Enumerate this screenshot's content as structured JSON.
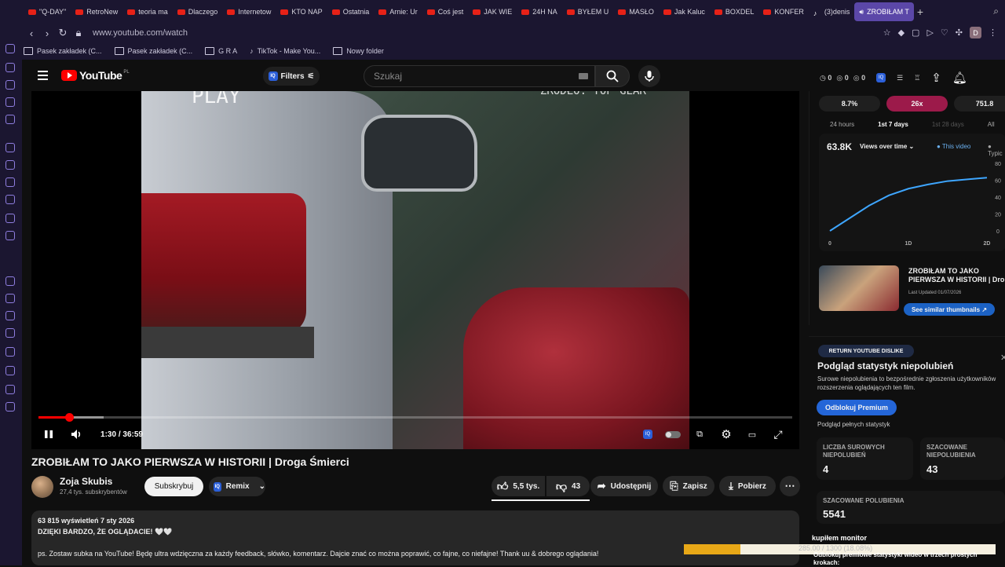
{
  "browser": {
    "tabs": [
      {
        "label": "\"Q-DAY\""
      },
      {
        "label": "RetroNew"
      },
      {
        "label": "teoria ma"
      },
      {
        "label": "Dlaczego"
      },
      {
        "label": "Internetow"
      },
      {
        "label": "KTO NAP"
      },
      {
        "label": "Ostatnia"
      },
      {
        "label": "Arnie: Ur"
      },
      {
        "label": "Coś jest"
      },
      {
        "label": "JAK WIE"
      },
      {
        "label": "24H NA"
      },
      {
        "label": "BYŁEM U"
      },
      {
        "label": "MASŁO"
      },
      {
        "label": "Jak Kaluc"
      },
      {
        "label": "BOXDEL"
      },
      {
        "label": "KONFER"
      },
      {
        "label": "(3)denis"
      },
      {
        "label": "ZROBIŁAM T"
      }
    ],
    "url": "www.youtube.com/watch",
    "avatar_letter": "D",
    "bookmarks": [
      {
        "label": "Pasek zakładek (C..."
      },
      {
        "label": "Pasek zakładek (C..."
      },
      {
        "label": "G R A"
      },
      {
        "label": "TikTok - Make You..."
      },
      {
        "label": "Nowy folder"
      }
    ]
  },
  "youtube": {
    "logo_text": "YouTube",
    "logo_region": "PL",
    "filters_label": "Filters",
    "search_placeholder": "Szukaj",
    "counts": [
      "0",
      "0",
      "0"
    ],
    "accent": "#ff0000"
  },
  "video": {
    "watermark_left": "PLAY",
    "watermark_right": "ŹRÓDŁO: TOP GEAR",
    "time": "1:30 / 36:59",
    "played_fraction": 0.041,
    "buffered_fraction": 0.086
  },
  "info": {
    "title": "ZROBIŁAM TO JAKO PIERWSZA W HISTORII | Droga Śmierci",
    "channel": "Zoja Skubis",
    "subs": "27,4 tys. subskrybentów",
    "subscribe": "Subskrybuj",
    "remix": "Remix",
    "likes": "5,5 tys.",
    "dislikes": "43",
    "share": "Udostępnij",
    "save": "Zapisz",
    "download": "Pobierz"
  },
  "description": {
    "line1": "63 815 wyświetleń  7 sty 2026",
    "line2": "DZIĘKI BARDZO, ŻE OGLĄDACIE! 🤍🤍",
    "line3": "ps. Zostaw subka na YouTube! Będę ultra wdzięczna za każdy feedback, słówko, komentarz. Dajcie znać co można poprawić, co fajne, co niefajne! Thank uu & dobrego oglądania!"
  },
  "stats_panel": {
    "pills": [
      "8.7%",
      "26x",
      "751.8"
    ],
    "tabs": [
      "24 hours",
      "1st 7 days",
      "1st 28 days",
      "All"
    ],
    "big": "63.8K",
    "mode": "Views over time ⌄",
    "legend_this": "This video",
    "legend_typical": "Typic",
    "thumb_title": "ZROBIŁAM TO JAKO PIERWSZA W HISTORII | Dro",
    "updated": "Last Updated 01/07/2026",
    "similar": "See similar thumbnails ↗",
    "accent": "#9c1a4a"
  },
  "chart_data": {
    "type": "line",
    "title": "",
    "x": [
      "0",
      "1D",
      "2D"
    ],
    "xlabel": "",
    "ylabel": "",
    "yticks": [
      "0",
      "20",
      "40",
      "60",
      "80"
    ],
    "ylim": [
      0,
      80
    ],
    "series": [
      {
        "name": "This video",
        "color": "#3ea6ff",
        "points": [
          [
            0,
            0
          ],
          [
            0.25,
            15
          ],
          [
            0.5,
            30
          ],
          [
            0.75,
            42
          ],
          [
            1,
            50
          ],
          [
            1.25,
            55
          ],
          [
            1.5,
            59
          ],
          [
            1.75,
            61
          ],
          [
            2,
            63
          ]
        ]
      }
    ]
  },
  "dislike_panel": {
    "badge": "RETURN YOUTUBE DISLIKE",
    "title": "Podgląd statystyk niepolubień",
    "subtitle": "Surowe niepolubienia to bezpośrednie zgłoszenia użytkowników rozszerzenia oglądających ten film.",
    "unlock": "Odblokuj Premium",
    "full": "Podgląd pełnych statystyk",
    "raw_label": "LICZBA SUROWYCH NIEPOLUBIEŃ",
    "raw_val": "4",
    "est_label": "SZACOWANE NIEPOLUBIENIA",
    "est_val": "43",
    "likes_label": "SZACOWANE POLUBIENIA",
    "likes_val": "5541",
    "promo": "Odblokuj premiowe statystyki wideo w trzech prostych krokach:"
  },
  "overlay": {
    "title": "kupiłem monitor",
    "progress_text": "285.00 / 1300 (18.08%)",
    "fraction": 0.1808
  }
}
